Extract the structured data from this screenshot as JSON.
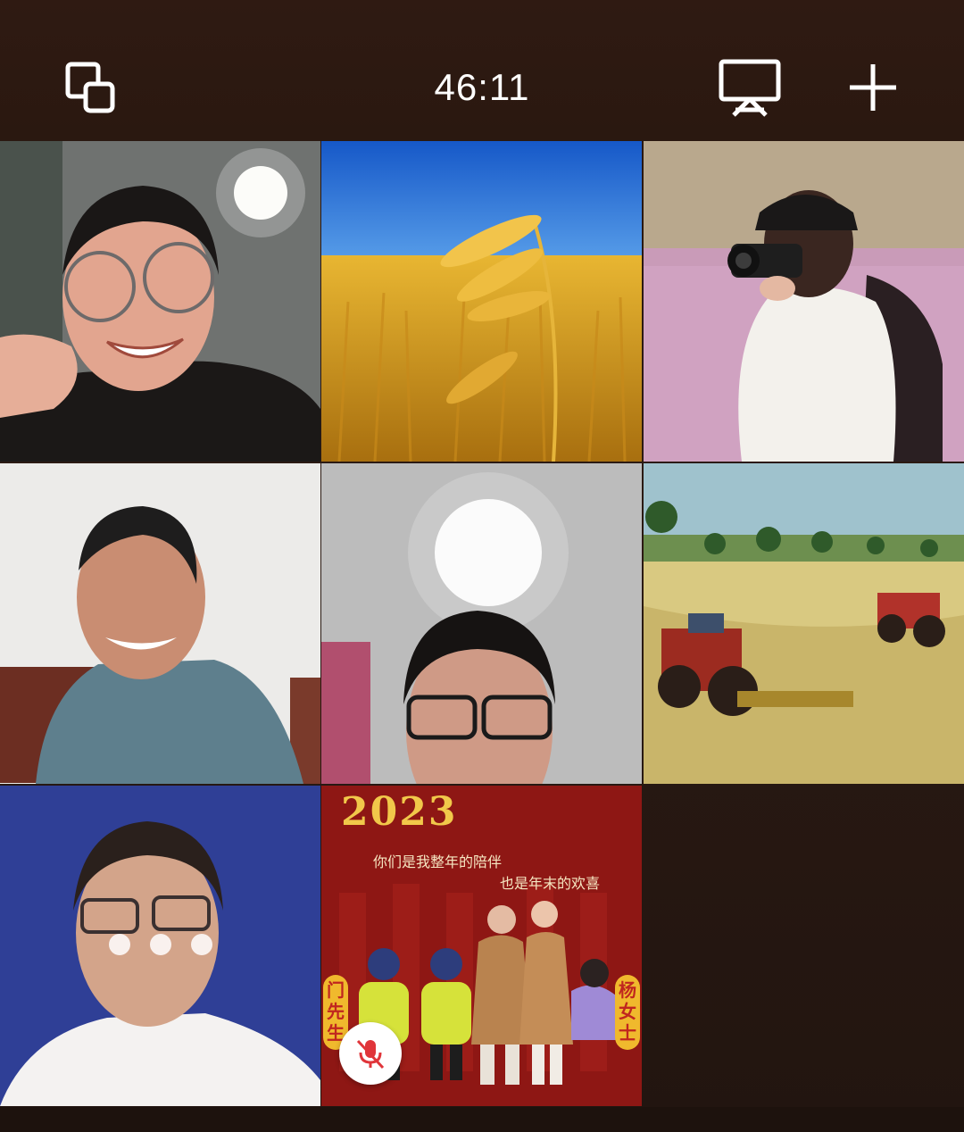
{
  "header": {
    "timer": "46:11",
    "left_icon": "switch-layout-icon",
    "right_icons": [
      "share-screen-icon",
      "add-icon"
    ]
  },
  "poster": {
    "year": "2023",
    "line1": "你们是我整年的陪伴",
    "line2": "也是年末的欢喜",
    "left_vertical": "门先生",
    "right_vertical": "杨女士"
  },
  "participants": [
    {
      "name": "participant-1",
      "type": "video",
      "muted": false
    },
    {
      "name": "participant-2",
      "type": "avatar-wheat",
      "muted": false
    },
    {
      "name": "participant-3",
      "type": "avatar-photographer",
      "muted": false
    },
    {
      "name": "participant-4",
      "type": "video",
      "muted": false
    },
    {
      "name": "participant-5",
      "type": "video",
      "muted": false
    },
    {
      "name": "participant-6",
      "type": "avatar-harvest-painting",
      "muted": false
    },
    {
      "name": "participant-7",
      "type": "video-loading",
      "muted": false
    },
    {
      "name": "participant-8",
      "type": "avatar-poster",
      "muted": true
    }
  ],
  "colors": {
    "background": "#2a1712",
    "mute_icon": "#e0353a",
    "poster_red": "#8e1714",
    "poster_gold": "#f1c84a"
  }
}
